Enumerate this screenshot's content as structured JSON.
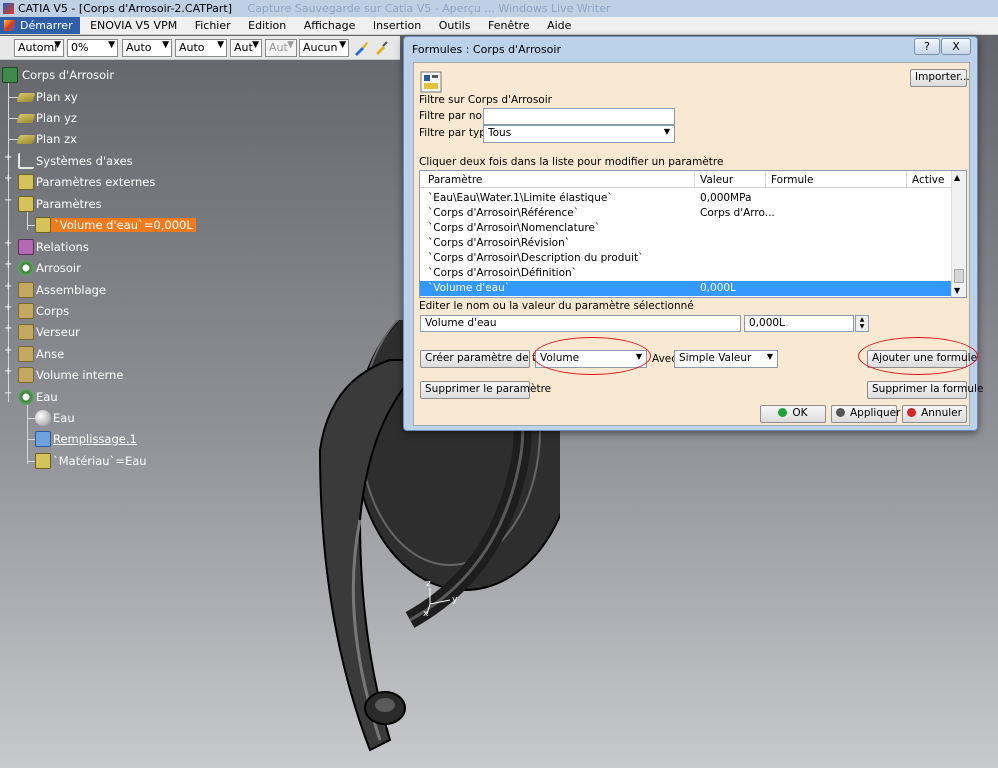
{
  "window": {
    "title": "CATIA V5 - [Corps d'Arrosoir-2.CATPart]",
    "ghost_title": "Capture Sauvegarde sur Catia V5 - Aperçu ... Windows Live Writer"
  },
  "menu": [
    "Démarrer",
    "ENOVIA V5 VPM",
    "Fichier",
    "Edition",
    "Affichage",
    "Insertion",
    "Outils",
    "Fenêtre",
    "Aide"
  ],
  "toolbar": {
    "combos": [
      "Automi",
      "0%",
      "Auto",
      "Auto",
      "Aut",
      "Aut",
      "Aucun"
    ]
  },
  "tree": {
    "root": "Corps d'Arrosoir",
    "plan_xy": "Plan xy",
    "plan_yz": "Plan yz",
    "plan_zx": "Plan zx",
    "systemes": "Systèmes d'axes",
    "param_ext": "Paramètres externes",
    "parametres": "Paramètres",
    "volume_eau": "`Volume d'eau`=0,000L",
    "relations": "Relations",
    "arrosoir": "Arrosoir",
    "assemblage": "Assemblage",
    "corps": "Corps",
    "verseur": "Verseur",
    "anse": "Anse",
    "volume_interne": "Volume interne",
    "eau_body": "Eau",
    "eau_mat": "Eau",
    "remplissage": "Remplissage.1",
    "materiau": "`Matériau`=Eau"
  },
  "axis": {
    "z": "z",
    "y": "y",
    "x": "x"
  },
  "dialog": {
    "title": "Formules : Corps d'Arrosoir",
    "help": "?",
    "close": "X",
    "import": "Importer...",
    "filter_title": "Filtre sur Corps d'Arrosoir",
    "filter_name_label": "Filtre par nom :",
    "filter_name_value": "",
    "filter_type_label": "Filtre par type :",
    "filter_type_value": "Tous",
    "list_hint": "Cliquer deux fois dans la liste pour modifier un paramètre",
    "columns": [
      "Paramètre",
      "Valeur",
      "Formule",
      "Active"
    ],
    "rows": [
      {
        "param": "`Eau\\Eau\\Water.1\\Limite élastique`",
        "value": "0,000MPa",
        "formula": "",
        "active": ""
      },
      {
        "param": "`Corps d'Arrosoir\\Référence`",
        "value": "Corps d'Arro...",
        "formula": "",
        "active": ""
      },
      {
        "param": "`Corps d'Arrosoir\\Nomenclature`",
        "value": "",
        "formula": "",
        "active": ""
      },
      {
        "param": "`Corps d'Arrosoir\\Révision`",
        "value": "",
        "formula": "",
        "active": ""
      },
      {
        "param": "`Corps d'Arrosoir\\Description du produit`",
        "value": "",
        "formula": "",
        "active": ""
      },
      {
        "param": "`Corps d'Arrosoir\\Définition`",
        "value": "",
        "formula": "",
        "active": ""
      },
      {
        "param": "`Volume d'eau`",
        "value": "0,000L",
        "formula": "",
        "active": ""
      }
    ],
    "edit_label": "Editer le nom ou la valeur du paramètre sélectionné",
    "edit_name": "Volume d'eau",
    "edit_value": "0,000L",
    "create_param": "Créer paramètre de type",
    "type_value": "Volume",
    "with_label": "Avec",
    "with_value": "Simple Valeur",
    "add_formula": "Ajouter une formule",
    "delete_param": "Supprimer le paramètre",
    "delete_formula": "Supprimer la formule",
    "ok": "OK",
    "apply": "Appliquer",
    "cancel": "Annuler"
  }
}
